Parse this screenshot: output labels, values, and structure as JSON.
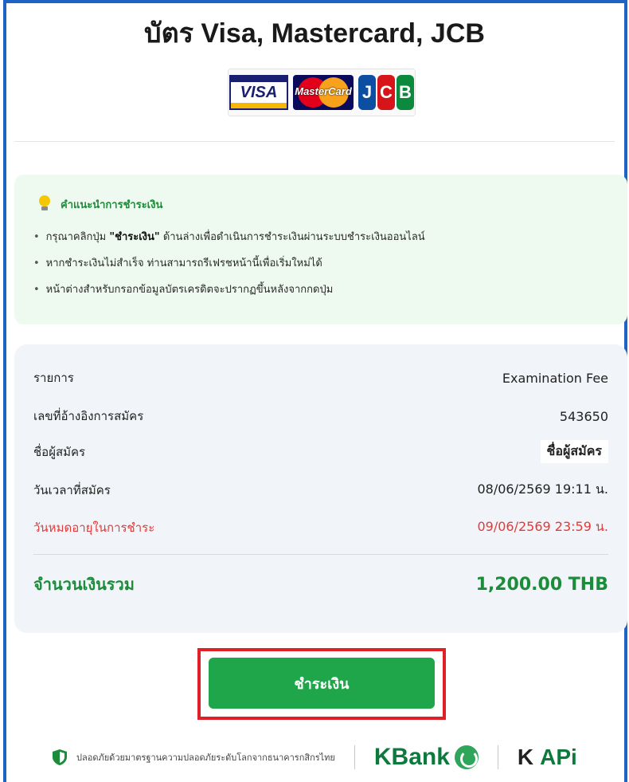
{
  "header": {
    "title": "บัตร Visa, Mastercard, JCB",
    "card_logos": {
      "visa": "VISA",
      "mastercard": "MasterCard",
      "jcb": [
        "J",
        "C",
        "B"
      ]
    }
  },
  "advice": {
    "title": "คำแนะนำการชำระเงิน",
    "icon": "lightbulb-icon",
    "items": [
      {
        "prefix": "กรุณาคลิกปุ่ม ",
        "bold": "\"ชำระเงิน\"",
        "suffix": " ด้านล่างเพื่อดำเนินการชำระเงินผ่านระบบชำระเงินออนไลน์"
      },
      {
        "prefix": "หากชำระเงินไม่สำเร็จ ท่านสามารถรีเฟรชหน้านี้เพื่อเริ่มใหม่ได้",
        "bold": "",
        "suffix": ""
      },
      {
        "prefix": "หน้าต่างสำหรับกรอกข้อมูลบัตรเครดิตจะปรากฏขึ้นหลังจากกดปุ่ม",
        "bold": "",
        "suffix": ""
      }
    ]
  },
  "summary": {
    "item_label": "รายการ",
    "item_value": "Examination Fee",
    "ref_label": "เลขที่อ้างอิงการสมัคร",
    "ref_value": "543650",
    "name_label": "ชื่อผู้สมัคร",
    "name_value": "ชื่อผู้สมัคร",
    "date_label": "วันเวลาที่สมัคร",
    "date_value": "08/06/2569 19:11 น.",
    "expire_label": "วันหมดอายุในการชำระ",
    "expire_value": "09/06/2569 23:59 น.",
    "total_label": "จำนวนเงินรวม",
    "total_value": "1,200.00 THB"
  },
  "pay_button": {
    "label": "ชำระเงิน"
  },
  "footer": {
    "security_text": "ปลอดภัยด้วยมาตรฐานความปลอดภัยระดับโลกจากธนาคารกสิกรไทย",
    "kbank": "KBank",
    "kapi_k": "K",
    "kapi_api": "APi"
  },
  "colors": {
    "brand_green": "#1fa64a",
    "frame_blue": "#1f63c5",
    "expire_red": "#e03a3a",
    "highlight_red": "#e01f26"
  }
}
